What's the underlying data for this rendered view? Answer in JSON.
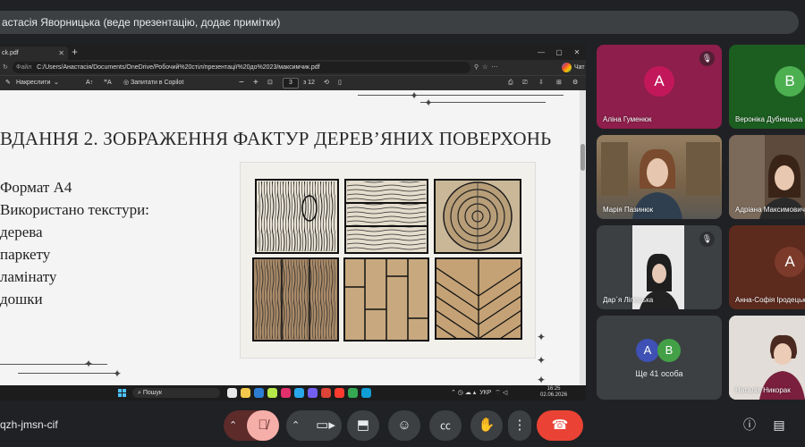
{
  "banner": {
    "text": "астасія Яворницька (веде презентацію, додає примітки)"
  },
  "browser": {
    "tab_title": "ck.pdf",
    "url_prefix": "Файл",
    "url": "C:/Users/Анастасія/Documents/OneDrive/Робочий%20стіл/презентації%20до%2023/максимчик.pdf",
    "profile_label": "Чат"
  },
  "pdf_toolbar": {
    "draw_label": "Накреслити",
    "copilot_label": "Запитати в Copilot",
    "zoom_out": "−",
    "zoom_in": "+",
    "page_current": "3",
    "page_total": "з 12"
  },
  "slide": {
    "title": "ВДАННЯ 2. ЗОБРАЖЕННЯ ФАКТУР ДЕРЕВ’ЯНИХ ПОВЕРХОНЬ",
    "lines": [
      "Формат А4",
      "Використано текстури:",
      "дерева",
      "паркету",
      "ламінату",
      "дошки"
    ]
  },
  "taskbar": {
    "search_label": "Пошук",
    "tray_lang": "УКР",
    "time": "16:25",
    "date": "02.06.2026"
  },
  "participants": [
    {
      "name": "Аліна Гуменюк",
      "initial": "А",
      "color": "#8e1e4b",
      "avatar_color": "#c2185b",
      "muted": true
    },
    {
      "name": "Вероніка Дубницька",
      "initial": "В",
      "color": "#1b5e20",
      "avatar_color": "#4caf50",
      "muted": false
    },
    {
      "name": "Марія Пазинюк",
      "initial": "",
      "color": "#6b5a45",
      "video": true,
      "muted": false
    },
    {
      "name": "Адріана Максимович",
      "initial": "",
      "color": "#4a3a30",
      "video": true,
      "muted": false
    },
    {
      "name": "Дар`я Ліпецька",
      "initial": "",
      "color": "#3c4043",
      "video": true,
      "muted": true
    },
    {
      "name": "Анна-Софія Іродецька",
      "initial": "А",
      "color": "#5d2a1e",
      "avatar_color": "#7b3a2a",
      "muted": false
    },
    {
      "name": "Ще 41 особа",
      "initials": [
        "А",
        "В"
      ],
      "color": "#3c4043"
    },
    {
      "name": "Наталія Никорак",
      "initial": "",
      "color": "#d8d4d0",
      "video": true,
      "muted": false
    }
  ],
  "meeting": {
    "code": "qzh-jmsn-cif"
  },
  "colors": {
    "end_call": "#ea4335",
    "mic_off": "#f6aea9"
  }
}
